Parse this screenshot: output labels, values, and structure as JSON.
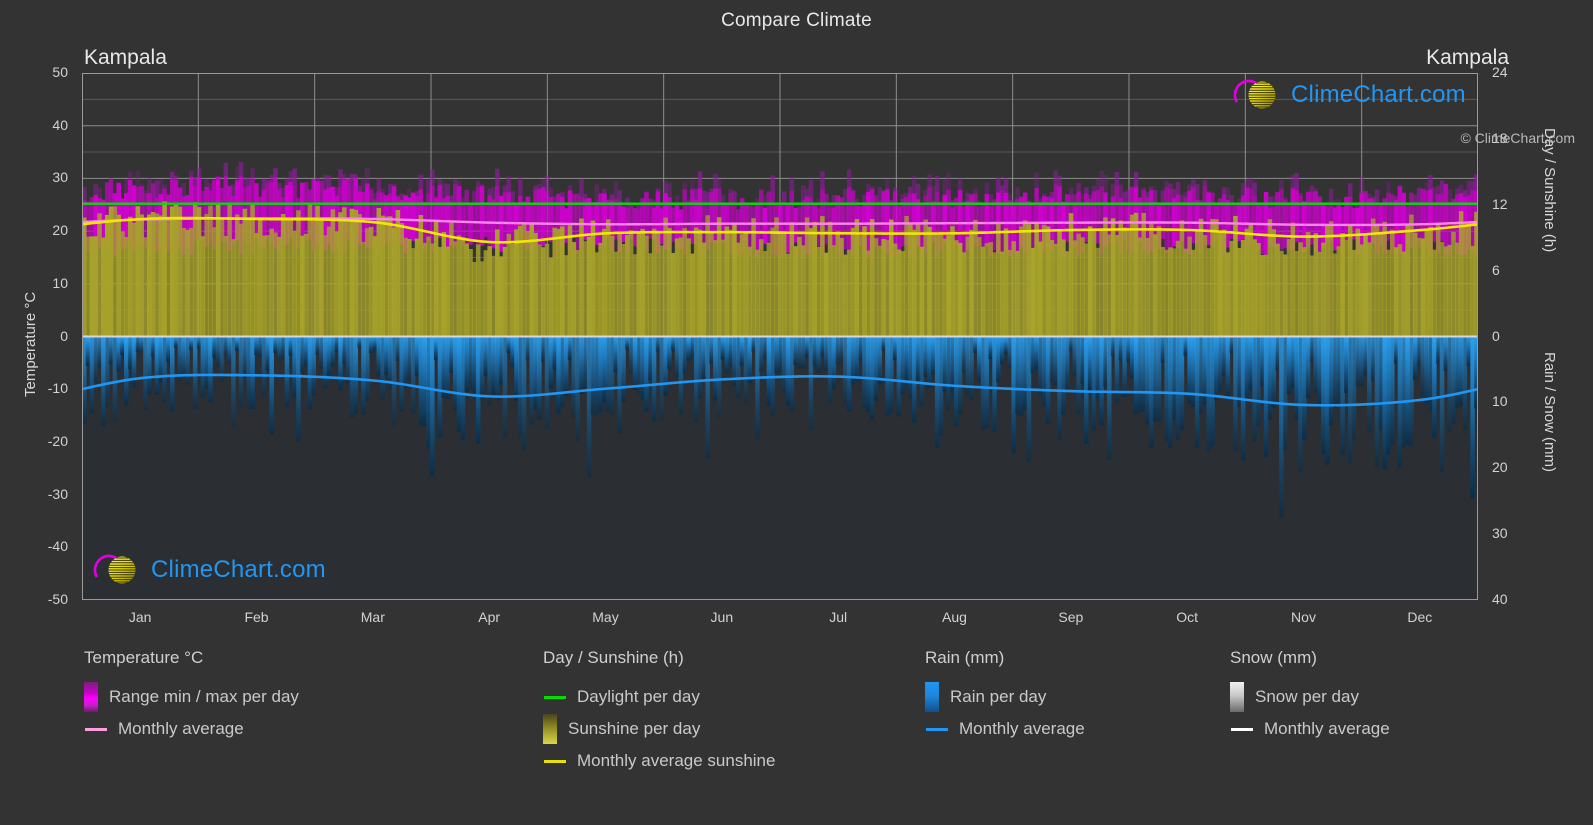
{
  "header": {
    "title": "Compare Climate"
  },
  "cities": {
    "left": "Kampala",
    "right": "Kampala"
  },
  "axes": {
    "left_label": "Temperature °C",
    "right_top_label": "Day / Sunshine (h)",
    "right_bottom_label": "Rain / Snow (mm)",
    "temp_ticks": [
      "50",
      "40",
      "30",
      "20",
      "10",
      "0",
      "-10",
      "-20",
      "-30",
      "-40",
      "-50"
    ],
    "day_ticks": [
      "24",
      "18",
      "12",
      "6",
      "0"
    ],
    "rain_ticks": [
      "0",
      "10",
      "20",
      "30",
      "40"
    ],
    "months": [
      "Jan",
      "Feb",
      "Mar",
      "Apr",
      "May",
      "Jun",
      "Jul",
      "Aug",
      "Sep",
      "Oct",
      "Nov",
      "Dec"
    ]
  },
  "legend": {
    "temperature": {
      "heading": "Temperature °C",
      "items": [
        {
          "label": "Range min / max per day",
          "type": "swatch",
          "color": "#ff00ff"
        },
        {
          "label": "Monthly average",
          "type": "line",
          "color": "#ff9ee0"
        }
      ]
    },
    "day_sunshine": {
      "heading": "Day / Sunshine (h)",
      "items": [
        {
          "label": "Daylight per day",
          "type": "line",
          "color": "#00e000"
        },
        {
          "label": "Sunshine per day",
          "type": "swatch",
          "color": "#d8d84a"
        },
        {
          "label": "Monthly average sunshine",
          "type": "line",
          "color": "#e8e000"
        }
      ]
    },
    "rain": {
      "heading": "Rain (mm)",
      "items": [
        {
          "label": "Rain per day",
          "type": "swatch",
          "color": "#2196f3"
        },
        {
          "label": "Monthly average",
          "type": "line",
          "color": "#2196f3"
        }
      ]
    },
    "snow": {
      "heading": "Snow (mm)",
      "items": [
        {
          "label": "Snow per day",
          "type": "swatch",
          "color": "#f2f2f2"
        },
        {
          "label": "Monthly average",
          "type": "line",
          "color": "#ffffff"
        }
      ]
    }
  },
  "watermark": {
    "text": "ClimeChart.com",
    "copyright": "© ClimeChart.com"
  },
  "chart_data": {
    "type": "area",
    "title": "Compare Climate",
    "location": "Kampala",
    "x": [
      "Jan",
      "Feb",
      "Mar",
      "Apr",
      "May",
      "Jun",
      "Jul",
      "Aug",
      "Sep",
      "Oct",
      "Nov",
      "Dec"
    ],
    "temperature_axis": {
      "label": "Temperature °C",
      "min": -50,
      "max": 50,
      "step": 10,
      "unit": "°C"
    },
    "day_sunshine_axis": {
      "label": "Day / Sunshine (h)",
      "min": 0,
      "max": 24,
      "step": 6,
      "unit": "h"
    },
    "rain_snow_axis": {
      "label": "Rain / Snow (mm)",
      "min": 0,
      "max": 40,
      "step": 10,
      "unit": "mm"
    },
    "grid": true,
    "legend_position": "bottom",
    "series": [
      {
        "name": "Monthly average temperature",
        "unit": "°C",
        "color": "#ff9ee0",
        "values": [
          22.2,
          22.4,
          22.3,
          21.6,
          21.3,
          21.4,
          21.4,
          21.5,
          21.6,
          21.6,
          21.2,
          21.3
        ]
      },
      {
        "name": "Range max per day",
        "unit": "°C",
        "color": "#cc00cc",
        "values": [
          27.8,
          28.1,
          27.6,
          26.4,
          25.9,
          25.8,
          25.9,
          26.2,
          26.6,
          26.5,
          26.0,
          26.4
        ]
      },
      {
        "name": "Range min per day",
        "unit": "°C",
        "color": "#cc00cc",
        "values": [
          16.8,
          17.1,
          17.3,
          17.4,
          17.2,
          16.6,
          16.3,
          16.5,
          16.7,
          17.0,
          17.1,
          16.9
        ]
      },
      {
        "name": "Daylight per day",
        "unit": "h",
        "color": "#00e000",
        "values": [
          12.1,
          12.1,
          12.1,
          12.1,
          12.1,
          12.1,
          12.1,
          12.1,
          12.1,
          12.1,
          12.1,
          12.1
        ]
      },
      {
        "name": "Monthly average sunshine",
        "unit": "h",
        "color": "#e8e000",
        "values": [
          10.7,
          10.7,
          10.4,
          8.6,
          9.4,
          9.5,
          9.4,
          9.4,
          9.7,
          9.7,
          9.1,
          9.7
        ]
      },
      {
        "name": "Monthly average rain",
        "unit": "mm",
        "color": "#2196f3",
        "values": [
          6.3,
          5.9,
          6.7,
          9.1,
          7.9,
          6.5,
          6.1,
          7.5,
          8.3,
          8.7,
          10.4,
          9.6
        ]
      },
      {
        "name": "Monthly average snow",
        "unit": "mm",
        "color": "#ffffff",
        "values": [
          0,
          0,
          0,
          0,
          0,
          0,
          0,
          0,
          0,
          0,
          0,
          0
        ]
      }
    ]
  }
}
